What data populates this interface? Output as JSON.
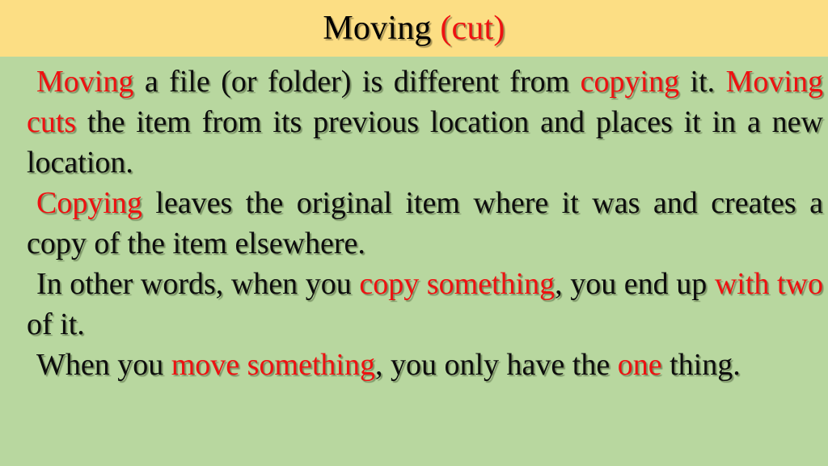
{
  "slide": {
    "title": {
      "main": "Moving",
      "parenthetical": "(cut)"
    },
    "colors": {
      "title_band_bg": "#fcde84",
      "body_bg": "#b8d79f",
      "accent_red": "#ee1111",
      "body_text": "#0d0d0d"
    },
    "paragraphs": [
      {
        "id": "paragraph-moving",
        "full_text": "Moving a file (or folder) is different from copying it. Moving cuts the item from its previous location and places it in a new location.",
        "runs": [
          {
            "text": "Moving",
            "color": "red"
          },
          {
            "text": " a file (or folder) is different from ",
            "color": "black"
          },
          {
            "text": "copying",
            "color": "red"
          },
          {
            "text": " it. ",
            "color": "black"
          },
          {
            "text": "Moving cuts",
            "color": "red"
          },
          {
            "text": " the item from its previous location and places it in a new location.",
            "color": "black"
          }
        ]
      },
      {
        "id": "paragraph-copying",
        "full_text": "Copying leaves the original item where it was and creates a copy of the item elsewhere.",
        "runs": [
          {
            "text": "Copying",
            "color": "red"
          },
          {
            "text": " leaves the original item where it was and creates a copy of the item elsewhere.",
            "color": "black"
          }
        ]
      },
      {
        "id": "paragraph-copy-result",
        "full_text": "In other words, when you copy something, you end up with two of it.",
        "runs": [
          {
            "text": "In other words, when you ",
            "color": "black"
          },
          {
            "text": "copy something",
            "color": "red"
          },
          {
            "text": ", you end up ",
            "color": "black"
          },
          {
            "text": "with two",
            "color": "red"
          },
          {
            "text": " of it.",
            "color": "black"
          }
        ]
      },
      {
        "id": "paragraph-move-result",
        "full_text": "When you move something, you only have the one thing.",
        "runs": [
          {
            "text": "When you ",
            "color": "black"
          },
          {
            "text": "move something",
            "color": "red"
          },
          {
            "text": ", you only have the ",
            "color": "black"
          },
          {
            "text": "one",
            "color": "red"
          },
          {
            "text": " thing.",
            "color": "black"
          }
        ]
      }
    ]
  }
}
